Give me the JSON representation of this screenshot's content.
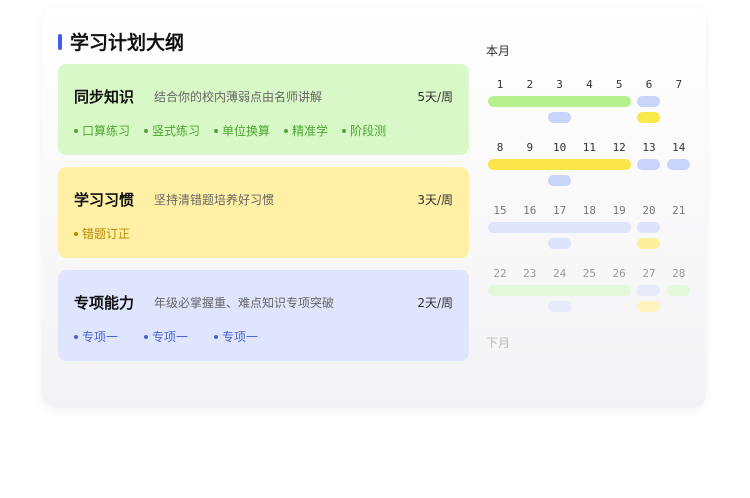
{
  "header": {
    "title": "学习计划大纲"
  },
  "plans": [
    {
      "name": "同步知识",
      "desc": "结合你的校内薄弱点由名师讲解",
      "freq": "5天/周",
      "tags": [
        "口算练习",
        "竖式练习",
        "单位换算",
        "精准学",
        "阶段测"
      ]
    },
    {
      "name": "学习习惯",
      "desc": "坚持清错题培养好习惯",
      "freq": "3天/周",
      "tags": [
        "错题订正"
      ]
    },
    {
      "name": "专项能力",
      "desc": "年级必掌握重、难点知识专项突破",
      "freq": "2天/周",
      "tags": [
        "专项一",
        "专项一",
        "专项一"
      ]
    }
  ],
  "calendar": {
    "current_label": "本月",
    "next_label": "下月",
    "weeks": [
      [
        "1",
        "2",
        "3",
        "4",
        "5",
        "6",
        "7"
      ],
      [
        "8",
        "9",
        "10",
        "11",
        "12",
        "13",
        "14"
      ],
      [
        "15",
        "16",
        "17",
        "18",
        "19",
        "20",
        "21"
      ],
      [
        "22",
        "23",
        "24",
        "25",
        "26",
        "27",
        "28"
      ]
    ]
  },
  "colors": {
    "accent": "#3f5cf0",
    "green": "#4aa82d",
    "green_bg": "#d9f8c7",
    "yellow": "#b88a00",
    "yellow_bg": "#fff0a6",
    "blue": "#4a62d8",
    "blue_bg": "#dfe5fd"
  }
}
